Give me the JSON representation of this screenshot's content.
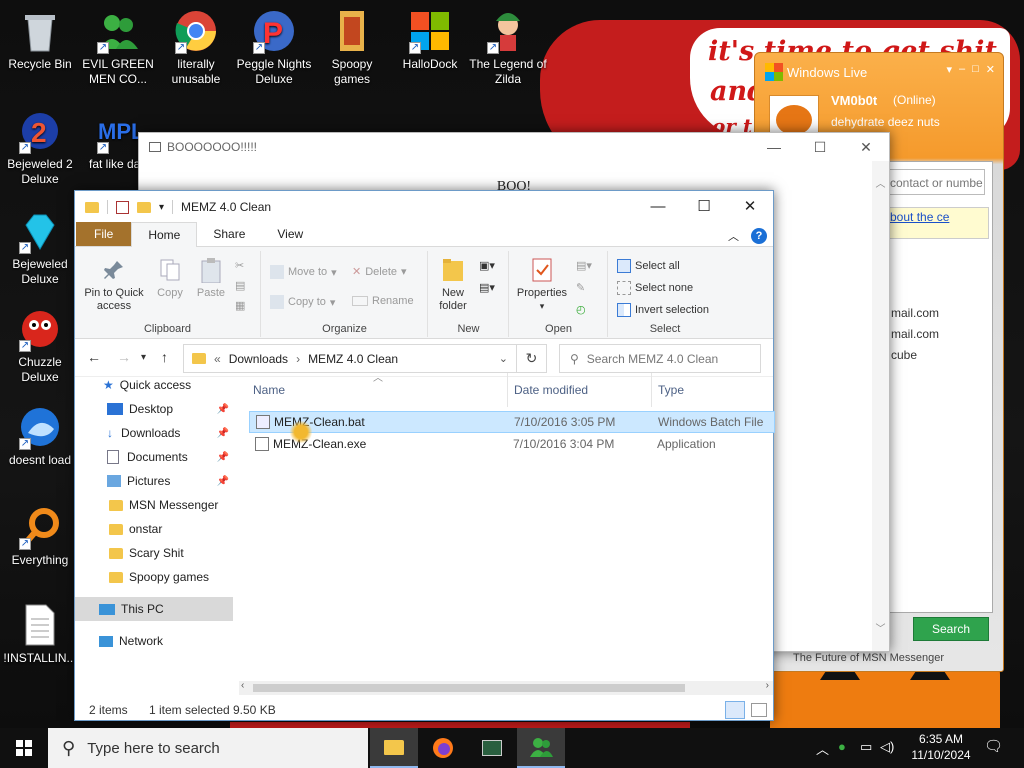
{
  "desktop": {
    "bg_text": [
      "it's time to get shit",
      "and",
      "or t"
    ],
    "icons": [
      {
        "label": "Recycle Bin",
        "icon": "recycle-bin-icon"
      },
      {
        "label": "EVIL GREEN MEN CO...",
        "icon": "msn-buddies-icon"
      },
      {
        "label": "literally unusable",
        "icon": "chrome-icon"
      },
      {
        "label": "Peggle Nights Deluxe",
        "icon": "peggle-icon"
      },
      {
        "label": "Spoopy games",
        "icon": "folder-icon"
      },
      {
        "label": "HalloDock",
        "icon": "windows-logo-icon"
      },
      {
        "label": "The Legend of Zilda",
        "icon": "zilda-icon"
      },
      {
        "label": "Bejeweled 2 Deluxe",
        "icon": "bejeweled2-icon"
      },
      {
        "label": "fat like darl",
        "icon": "mpl-icon"
      },
      {
        "label": "Bejeweled Deluxe",
        "icon": "diamond-icon"
      },
      {
        "label": "Chuzzle Deluxe",
        "icon": "chuzzle-icon"
      },
      {
        "label": "doesnt load",
        "icon": "thunderbird-icon"
      },
      {
        "label": "Everything",
        "icon": "everything-search-icon"
      },
      {
        "label": "!INSTALLIN...",
        "icon": "text-document-icon"
      }
    ]
  },
  "boo_window": {
    "title": "BOOOOOOO!!!!!",
    "message": "BOO!"
  },
  "msn": {
    "title": "Windows Live",
    "username": "VM0b0t",
    "status": "(Online)",
    "personal_message": "dehydrate deez nuts",
    "search_placeholder": "contact or numbe",
    "advert_text": "bout the ce",
    "contacts": [
      "mail.com",
      "mail.com",
      "cube"
    ],
    "search_button": "Search",
    "footer": "The Future of MSN Messenger"
  },
  "explorer": {
    "title": "MEMZ 4.0 Clean",
    "tabs": {
      "file": "File",
      "home": "Home",
      "share": "Share",
      "view": "View"
    },
    "ribbon": {
      "clipboard": {
        "label": "Clipboard",
        "pin": "Pin to Quick access",
        "copy": "Copy",
        "paste": "Paste"
      },
      "organize": {
        "label": "Organize",
        "move_to": "Move to",
        "copy_to": "Copy to",
        "delete": "Delete",
        "rename": "Rename"
      },
      "new": {
        "label": "New",
        "new_folder": "New folder"
      },
      "open": {
        "label": "Open",
        "properties": "Properties"
      },
      "select": {
        "label": "Select",
        "select_all": "Select all",
        "select_none": "Select none",
        "invert": "Invert selection"
      }
    },
    "address": {
      "crumbs": [
        "Downloads",
        "MEMZ 4.0 Clean"
      ],
      "search_placeholder": "Search MEMZ 4.0 Clean"
    },
    "nav": {
      "quick_access": "Quick access",
      "pinned": [
        {
          "label": "Desktop",
          "icon": "desktop-icon"
        },
        {
          "label": "Downloads",
          "icon": "downloads-icon"
        },
        {
          "label": "Documents",
          "icon": "documents-icon"
        },
        {
          "label": "Pictures",
          "icon": "pictures-icon"
        }
      ],
      "folders": [
        "MSN Messenger",
        "onstar",
        "Scary Shit",
        "Spoopy games"
      ],
      "this_pc": "This PC",
      "network": "Network"
    },
    "columns": {
      "name": "Name",
      "date": "Date modified",
      "type": "Type"
    },
    "files": [
      {
        "name": "MEMZ-Clean.bat",
        "date": "7/10/2016 3:05 PM",
        "type": "Windows Batch File"
      },
      {
        "name": "MEMZ-Clean.exe",
        "date": "7/10/2016 3:04 PM",
        "type": "Application"
      }
    ],
    "status": {
      "count": "2 items",
      "selected": "1 item selected",
      "size": "9.50 KB"
    }
  },
  "taskbar": {
    "search_placeholder": "Type here to search",
    "time": "6:35 AM",
    "date": "11/10/2024"
  },
  "colors": {
    "file_tab": "#a4722c",
    "selection": "#cce8ff",
    "msn_orange": "#f59a2c",
    "accent_blue": "#1a6fd6"
  }
}
